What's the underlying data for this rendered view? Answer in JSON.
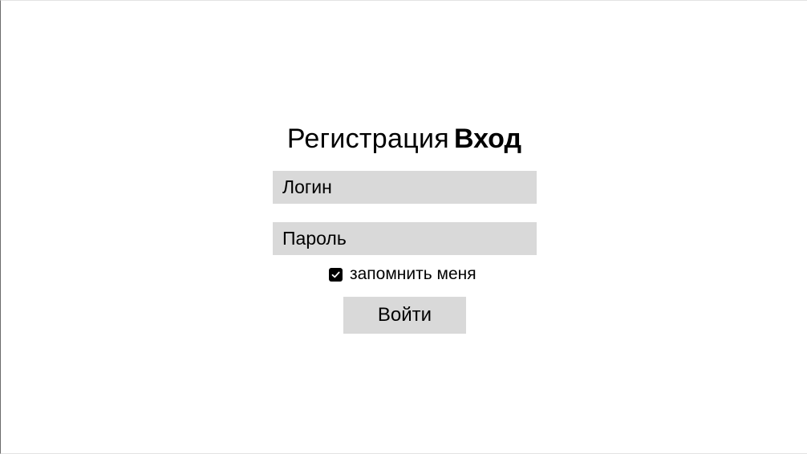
{
  "auth_tabs": {
    "register_label": "Регистрация",
    "login_label": "Вход",
    "active": "login"
  },
  "form": {
    "login_placeholder": "Логин",
    "login_value": "",
    "password_placeholder": "Пароль",
    "password_value": "",
    "remember_label": "запомнить меня",
    "remember_checked": true,
    "submit_label": "Войти"
  },
  "colors": {
    "field_background": "#d9d9d9",
    "text": "#000000",
    "page_background": "#ffffff"
  },
  "icons": {
    "checkbox": "checkmark-icon"
  }
}
